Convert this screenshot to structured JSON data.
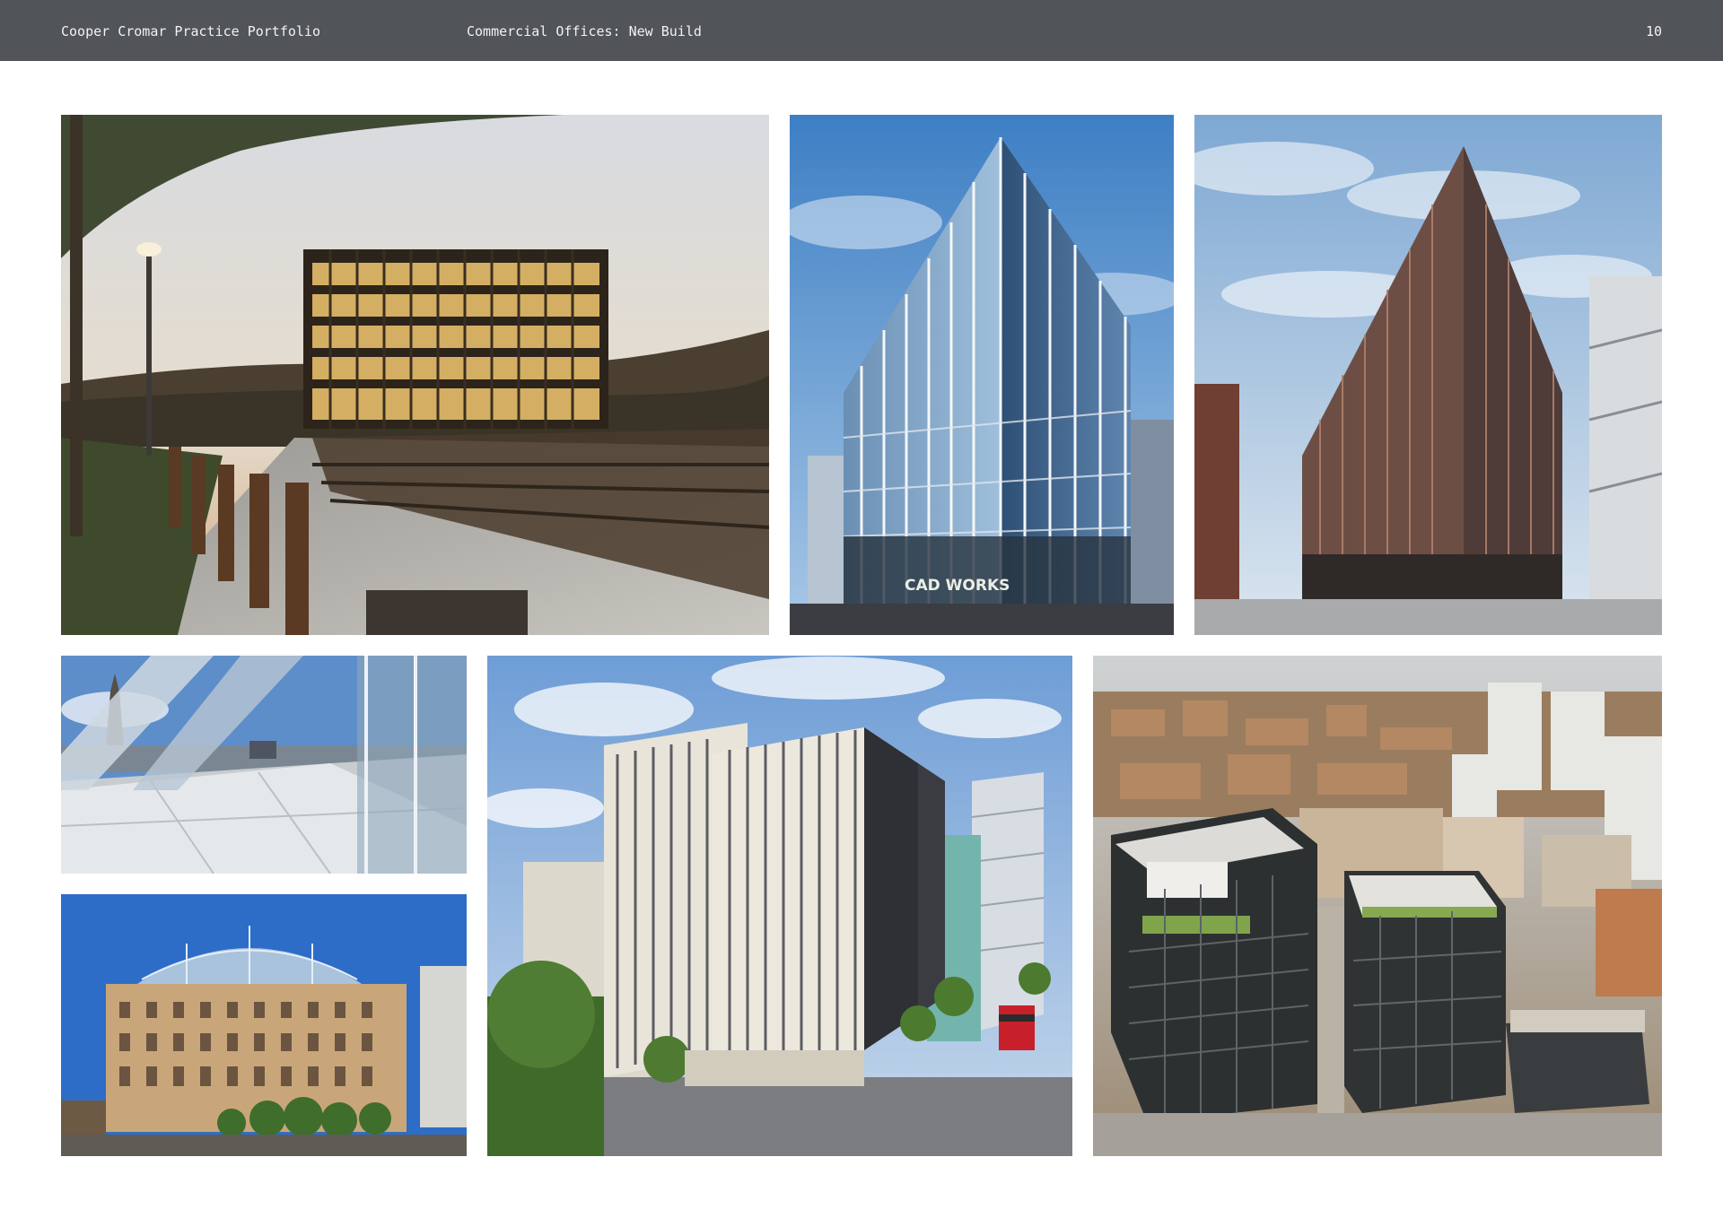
{
  "header": {
    "portfolio_title": "Cooper Cromar Practice Portfolio",
    "section_title": "Commercial Offices: New Build",
    "page_number": "10"
  },
  "photos": [
    {
      "subject": "glass office cube beside riverside boardwalk at dusk"
    },
    {
      "subject": "glazed corner office tower under blue sky",
      "sign_text": "CAD WORKS"
    },
    {
      "subject": "bronze framed corner office building on city street"
    },
    {
      "subject": "glass canopy roof terrace with church spire"
    },
    {
      "subject": "sandstone building with glazed barrel roof"
    },
    {
      "subject": "white stone office block with vertical fins and red bus"
    },
    {
      "subject": "aerial view of dark glazed office blocks in city"
    }
  ],
  "text": {
    "sign": "CAD WORKS"
  }
}
